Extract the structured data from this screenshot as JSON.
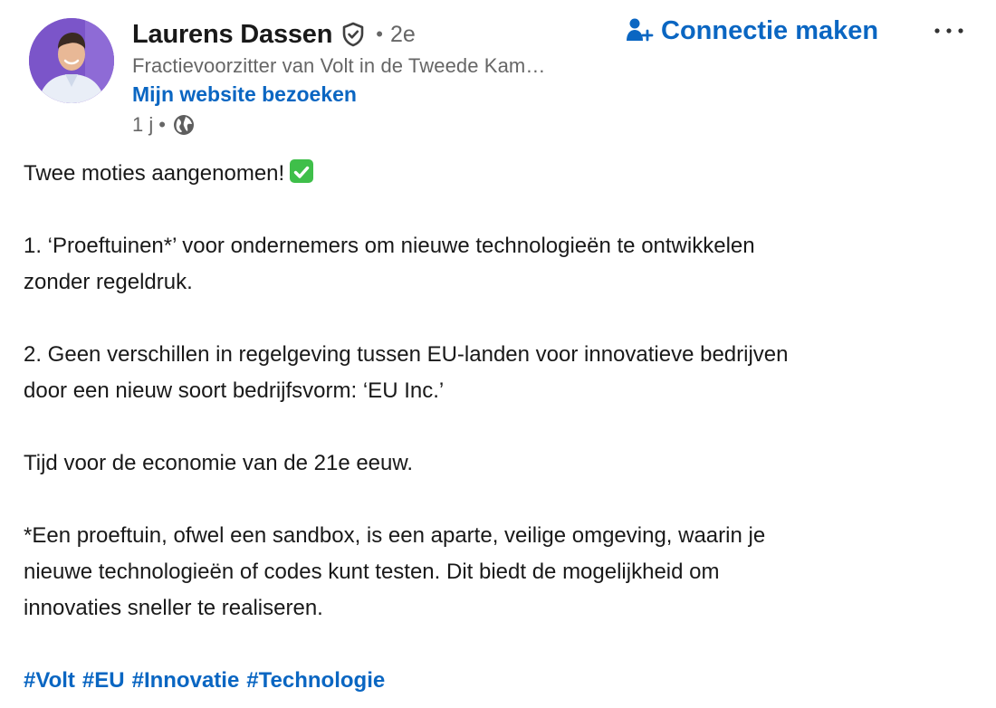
{
  "author": {
    "name": "Laurens Dassen",
    "degree_separator": "•",
    "degree": "2e",
    "headline": "Fractievoorzitter van Volt in de Tweede Kam…",
    "website_link": "Mijn website bezoeken",
    "avatar_icon": "profile-photo"
  },
  "meta": {
    "age": "1 j",
    "separator": "•",
    "visibility_icon": "globe-icon"
  },
  "actions": {
    "connect_label": "Connectie maken",
    "connect_icon": "person-add-icon",
    "more_icon": "more-horizontal-icon"
  },
  "colors": {
    "link_blue": "#0a66c2",
    "secondary_text": "#666666",
    "primary_text": "#191919",
    "check_green": "#3fbf4a"
  },
  "post": {
    "intro": "Twee moties aangenomen!",
    "intro_emoji": "white-check-mark",
    "point1": "1. ‘Proeftuinen*’ voor ondernemers om nieuwe technologieën te ontwikkelen\nzonder regeldruk.",
    "point2": "2. Geen verschillen in regelgeving tussen EU-landen voor innovatieve bedrijven\ndoor een nieuw soort bedrijfsvorm: ‘EU Inc.’",
    "closing": "Tijd voor de economie van de 21e eeuw.",
    "footnote": "*Een proeftuin, ofwel een sandbox, is een aparte, veilige omgeving, waarin je\nnieuwe technologieën of codes kunt testen. Dit biedt de mogelijkheid om\ninnovaties sneller te realiseren.",
    "hashtags": [
      "#Volt",
      "#EU",
      "#Innovatie",
      "#Technologie"
    ]
  }
}
